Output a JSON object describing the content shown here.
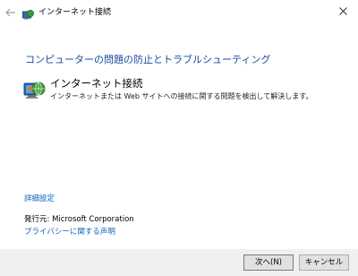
{
  "window": {
    "title": "インターネット接続"
  },
  "main": {
    "heading": "コンピューターの問題の防止とトラブルシューティング",
    "item": {
      "title": "インターネット接続",
      "description": "インターネットまたは Web サイトへの接続に関する問題を検出して解決します。"
    },
    "advanced_link": "詳細設定",
    "publisher": "発行元:  Microsoft Corporation",
    "privacy_link": "プライバシーに関する声明"
  },
  "buttons": {
    "next_label": "次へ(N)",
    "cancel_label": "キャンセル"
  },
  "icons": {
    "back": "back-arrow-icon",
    "title": "network-globe-icon",
    "item": "network-globe-icon",
    "close": "close-icon"
  },
  "colors": {
    "heading": "#1a4a9c",
    "link": "#0f64b8",
    "footer_bg": "#f0f0f0"
  }
}
